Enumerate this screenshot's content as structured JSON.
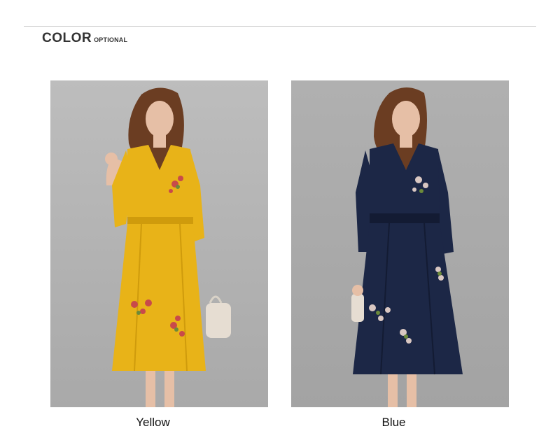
{
  "header": {
    "title": "COLOR",
    "subtitle": "OPTIONAL"
  },
  "products": [
    {
      "label": "Yellow",
      "dress_color": "#e8b318",
      "dress_shade": "#cf9b0c",
      "background": "#b7b7b7"
    },
    {
      "label": "Blue",
      "dress_color": "#1c2746",
      "dress_shade": "#131b33",
      "background": "#ababab"
    }
  ],
  "colors": {
    "skin": "#e6bfa6",
    "hair": "#6b3d22",
    "bag": "#e6ddd2",
    "embroidery": "#c84a4a",
    "leaf": "#6c8a3a"
  }
}
